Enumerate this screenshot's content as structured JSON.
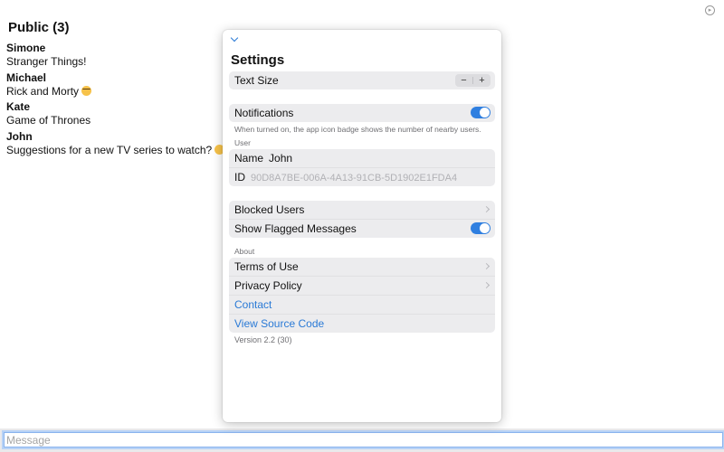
{
  "chat": {
    "title": "Public (3)",
    "messages": [
      {
        "sender": "Simone",
        "text": "Stranger Things!",
        "emoji": ""
      },
      {
        "sender": "Michael",
        "text": "Rick and Morty",
        "emoji": "nerd-face-emoji"
      },
      {
        "sender": "Kate",
        "text": "Game of Thrones",
        "emoji": ""
      },
      {
        "sender": "John",
        "text": "Suggestions for a new TV series to watch?",
        "emoji": "thinking-face-emoji"
      }
    ]
  },
  "composer": {
    "placeholder": "Message"
  },
  "settings": {
    "title": "Settings",
    "text_size": {
      "label": "Text Size",
      "minus": "−",
      "plus": "+"
    },
    "notifications": {
      "label": "Notifications",
      "enabled": true,
      "caption": "When turned on, the app icon badge shows the number of nearby users."
    },
    "user": {
      "header": "User",
      "name_label": "Name",
      "name_value": "John",
      "id_label": "ID",
      "id_value": "90D8A7BE-006A-4A13-91CB-5D1902E1FDA4"
    },
    "moderation": {
      "blocked_users": "Blocked Users",
      "show_flagged": "Show Flagged Messages",
      "show_flagged_enabled": true
    },
    "about": {
      "header": "About",
      "terms": "Terms of Use",
      "privacy": "Privacy Policy",
      "contact": "Contact",
      "source": "View Source Code"
    },
    "version": "Version 2.2 (30)"
  },
  "colors": {
    "accent": "#2f7fe0",
    "link": "#2a7ad6",
    "group_bg": "#ececee"
  }
}
